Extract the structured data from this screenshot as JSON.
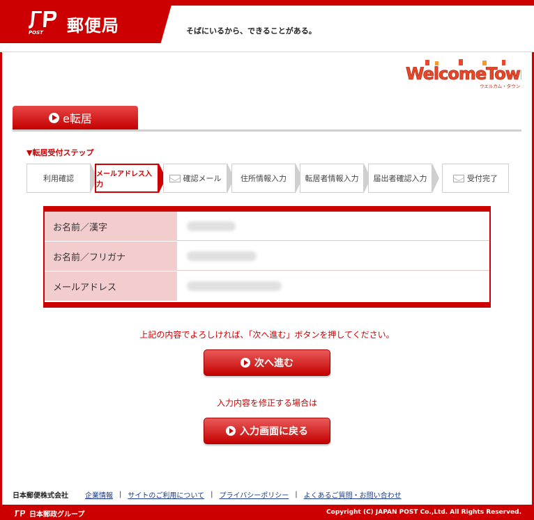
{
  "header": {
    "logo_text": "郵便局",
    "logo_mark_label": "POST",
    "slogan": "そばにいるから、できることがある。"
  },
  "welcome_town": {
    "title": "WelcomeTown",
    "subtitle": "ウエルカム・タウン"
  },
  "section": {
    "tab_label": "e転居"
  },
  "steps": {
    "title": "▼転居受付ステップ",
    "items": [
      {
        "label": "利用確認",
        "state": "done"
      },
      {
        "label": "メールアドレス入力",
        "state": "current"
      },
      {
        "label": "確認メール",
        "state": "todo",
        "icon": "envelope-icon"
      },
      {
        "label": "住所情報入力",
        "state": "todo"
      },
      {
        "label": "転居者情報入力",
        "state": "todo"
      },
      {
        "label": "届出者確認入力",
        "state": "todo"
      },
      {
        "label": "受付完了",
        "state": "todo",
        "icon": "envelope-icon"
      }
    ]
  },
  "info_table": {
    "rows": [
      {
        "label": "お名前／漢字"
      },
      {
        "label": "お名前／フリガナ"
      },
      {
        "label": "メールアドレス"
      }
    ]
  },
  "messages": {
    "confirm": "上記の内容でよろしければ、「次へ進む」ボタンを押してください。",
    "edit": "入力内容を修正する場合は"
  },
  "buttons": {
    "next": "次へ進む",
    "back": "入力画面に戻る"
  },
  "footer": {
    "company": "日本郵便株式会社",
    "links": [
      "企業情報",
      "サイトのご利用について",
      "プライバシーポリシー",
      "よくあるご質問・お問い合わせ"
    ],
    "group_logo": "日本郵政グループ",
    "copyright": "Copyright (C) JAPAN POST Co.,Ltd.  All Rights Reserved."
  },
  "colors": {
    "brand_red": "#cc0000",
    "label_pink": "#f3cdcd",
    "link_blue": "#1a3a8a"
  }
}
